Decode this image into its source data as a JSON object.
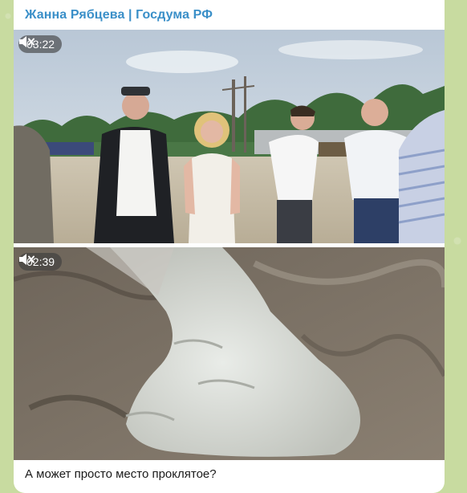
{
  "message": {
    "channel_name": "Жанна Рябцева | Госдума РФ",
    "caption": "А может просто место проклятое?",
    "accent_color": "#3a8fc8"
  },
  "videos": [
    {
      "duration": "03:22",
      "muted_icon": "speaker-muted-icon"
    },
    {
      "duration": "02:39",
      "muted_icon": "speaker-muted-icon"
    }
  ]
}
